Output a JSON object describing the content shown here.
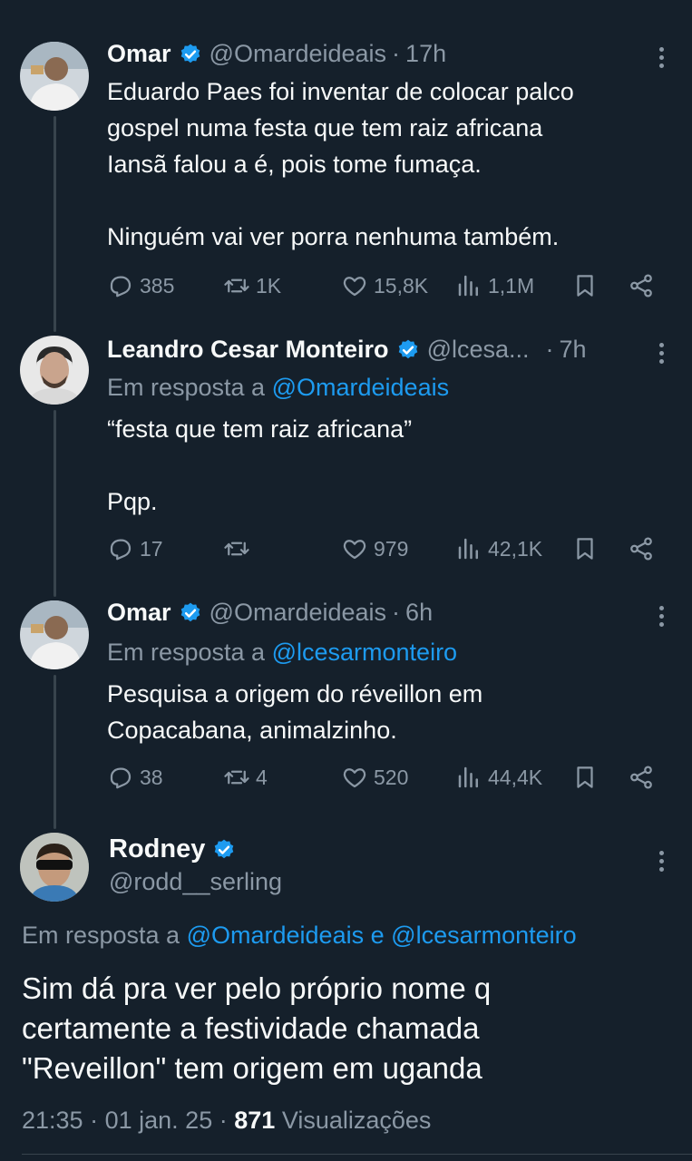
{
  "tweets": [
    {
      "name": "Omar",
      "handle": "@Omardeideais",
      "time": "17h",
      "text_lines": [
        "Eduardo Paes foi inventar de colocar palco",
        "gospel numa festa que tem raiz africana",
        "Iansã falou a é, pois tome fumaça.",
        "",
        "Ninguém vai ver porra nenhuma também."
      ],
      "stats": {
        "replies": "385",
        "retweets": "1K",
        "likes": "15,8K",
        "views": "1,1M"
      }
    },
    {
      "name": "Leandro Cesar Monteiro",
      "handle": "@lcesa...",
      "time": "7h",
      "reply_prefix": "Em resposta a",
      "reply_to": "@Omardeideais",
      "text_lines": [
        "“festa que tem raiz africana”",
        "",
        "Pqp."
      ],
      "stats": {
        "replies": "17",
        "retweets": "",
        "likes": "979",
        "views": "42,1K"
      }
    },
    {
      "name": "Omar",
      "handle": "@Omardeideais",
      "time": "6h",
      "reply_prefix": "Em resposta a",
      "reply_to": "@lcesarmonteiro",
      "text_lines": [
        "Pesquisa a origem do réveillon em",
        "Copacabana, animalzinho."
      ],
      "stats": {
        "replies": "38",
        "retweets": "4",
        "likes": "520",
        "views": "44,4K"
      }
    }
  ],
  "main_tweet": {
    "name": "Rodney",
    "handle": "@rodd__serling",
    "reply_prefix": "Em resposta a",
    "reply_to_1": "@Omardeideais",
    "reply_joiner": "e",
    "reply_to_2": "@lcesarmonteiro",
    "text_lines": [
      "Sim dá pra ver pelo próprio nome q",
      "certamente a festividade chamada",
      "\"Reveillon\" tem origem em uganda"
    ],
    "time": "21:35",
    "date": "01 jan. 25",
    "views_count": "871",
    "views_label": "Visualizações"
  },
  "separator": "·",
  "colors": {
    "bg": "#15202b",
    "text": "#f7f9f9",
    "muted": "#8b98a5",
    "link": "#1d9bf0",
    "line": "#38444d"
  },
  "icons": [
    "verified-badge-icon",
    "more-options-icon",
    "reply-icon",
    "retweet-icon",
    "like-icon",
    "views-icon",
    "bookmark-icon",
    "share-icon"
  ]
}
